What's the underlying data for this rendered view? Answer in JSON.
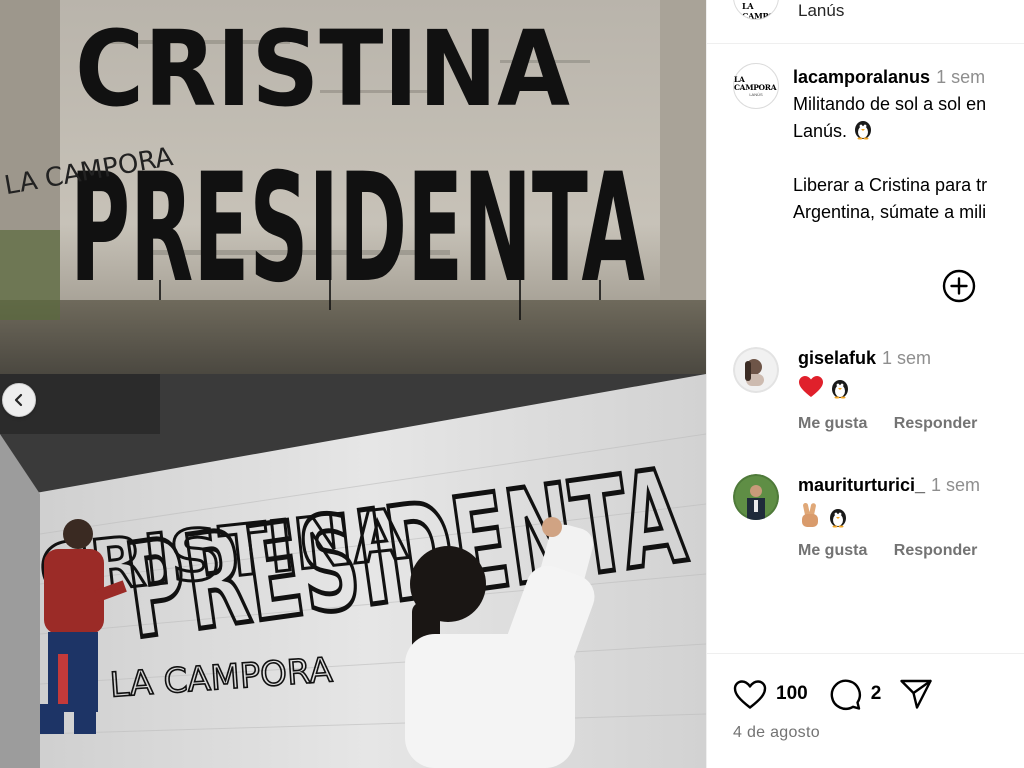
{
  "post_image": {
    "top_wall_text": [
      "CRISTINA",
      "PRESIDENTA"
    ],
    "top_small_text": "LA CAMPORA",
    "bottom_wall_text": [
      "CRISTINA",
      "PRESIDENTA"
    ],
    "bottom_small_text": "LA CAMPORA",
    "prev_icon": "chevron-left-icon"
  },
  "header": {
    "avatar_logo": "LA CAMPORA",
    "location": "Lanús"
  },
  "caption": {
    "avatar_logo": "LA CAMPORA",
    "avatar_sub": "LANÚS",
    "username": "lacamporalanus",
    "time": "1 sem",
    "line1": "Militando de sol a sol en",
    "line2": "Lanús.",
    "line3": "Liberar a Cristina para tr",
    "line4": "Argentina, súmate a mili",
    "emoji": "penguin"
  },
  "more_comments_icon": "plus-circle-icon",
  "comments": [
    {
      "username": "giselafuk",
      "time": "1 sem",
      "emojis": [
        "red-heart",
        "penguin"
      ],
      "like_label": "Me gusta",
      "reply_label": "Responder"
    },
    {
      "username": "mauriturturici_",
      "time": "1 sem",
      "emojis": [
        "victory-hand",
        "penguin"
      ],
      "like_label": "Me gusta",
      "reply_label": "Responder"
    }
  ],
  "actions": {
    "like_icon": "heart-outline-icon",
    "like_count": "100",
    "comment_icon": "comment-bubble-icon",
    "comment_count": "2",
    "share_icon": "send-icon"
  },
  "date": "4 de agosto",
  "colors": {
    "muted": "#737373",
    "time": "#8e8e8e",
    "border": "#efefef"
  }
}
